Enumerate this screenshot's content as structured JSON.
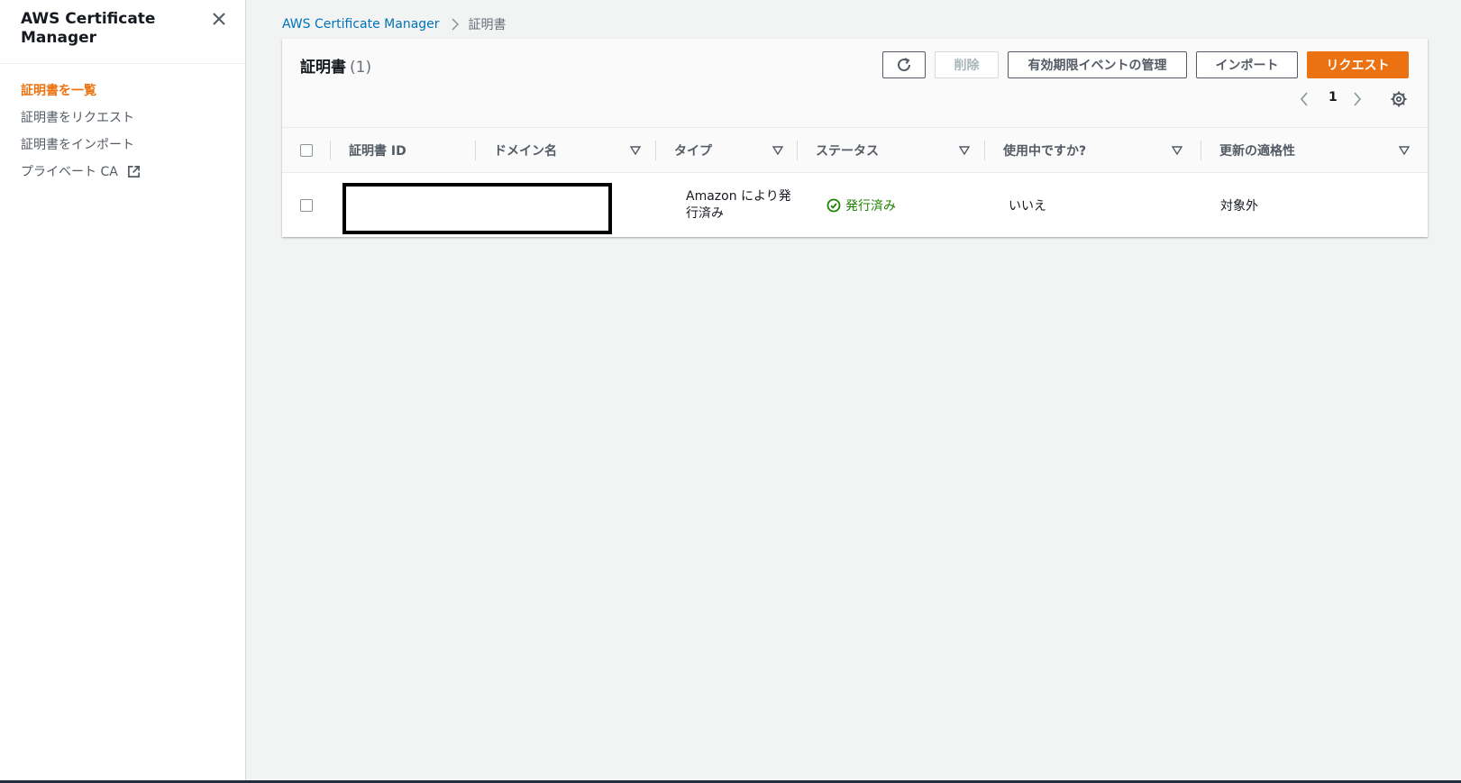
{
  "sidebar": {
    "title": "AWS Certificate Manager",
    "items": [
      {
        "label": "証明書を一覧",
        "active": true
      },
      {
        "label": "証明書をリクエスト",
        "active": false
      },
      {
        "label": "証明書をインポート",
        "active": false
      },
      {
        "label": "プライベート CA",
        "active": false,
        "external": true
      }
    ]
  },
  "breadcrumb": {
    "parent": "AWS Certificate Manager",
    "current": "証明書"
  },
  "panel": {
    "title": "証明書",
    "count": "(1)",
    "buttons": {
      "delete": "削除",
      "expiry": "有効期限イベントの管理",
      "import": "インポート",
      "request": "リクエスト"
    },
    "pagination": {
      "current_page": "1"
    }
  },
  "table": {
    "columns": [
      "証明書 ID",
      "ドメイン名",
      "タイプ",
      "ステータス",
      "使用中ですか?",
      "更新の適格性"
    ],
    "rows": [
      {
        "type": "Amazon により発行済み",
        "type_line1": "Amazon により発",
        "type_line2": "行済み",
        "status": "発行済み",
        "in_use": "いいえ",
        "renewal": "対象外"
      }
    ]
  },
  "colors": {
    "accent_orange": "#ec7211",
    "link_blue": "#0073bb",
    "success_green": "#1d8102"
  },
  "icons": [
    "close-icon",
    "external-link-icon",
    "chevron-right-icon",
    "refresh-icon",
    "chevron-left-icon",
    "gear-icon",
    "sort-triangle-icon",
    "check-circle-icon"
  ]
}
